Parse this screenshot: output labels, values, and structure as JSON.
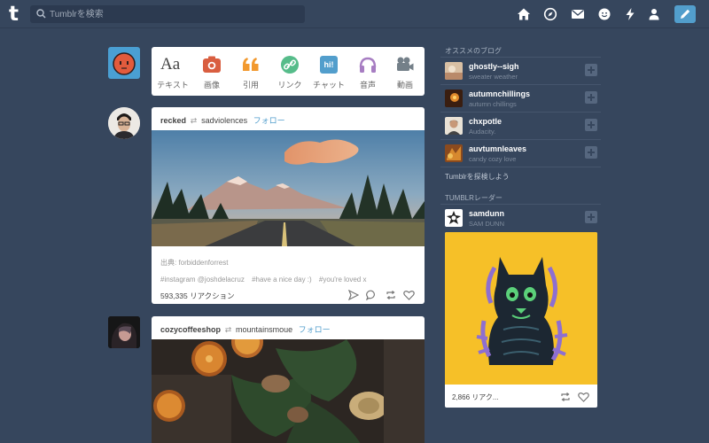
{
  "header": {
    "logo": "t",
    "search_placeholder": "Tumblrを検索",
    "nav_icons": [
      "home-icon",
      "explore-compass-icon",
      "inbox-mail-icon",
      "messages-smiley-icon",
      "activity-bolt-icon",
      "account-person-icon"
    ],
    "compose_icon": "pencil-icon"
  },
  "composer": {
    "types": [
      {
        "label": "テキスト",
        "icon": "text-Aa-icon",
        "glyph": "Aa",
        "color": "#444444"
      },
      {
        "label": "画像",
        "icon": "camera-icon",
        "color": "#d95e40"
      },
      {
        "label": "引用",
        "icon": "quote-icon",
        "color": "#f2992e"
      },
      {
        "label": "リンク",
        "icon": "link-icon",
        "color": "#56bc8a"
      },
      {
        "label": "チャット",
        "icon": "chat-icon",
        "glyph": "hi!",
        "color": "#529ecc"
      },
      {
        "label": "音声",
        "icon": "headphones-icon",
        "color": "#a77dc2"
      },
      {
        "label": "動画",
        "icon": "video-camera-icon",
        "color": "#748089"
      }
    ]
  },
  "posts": [
    {
      "user": "recked",
      "reblogged_from": "sadviolences",
      "follow": "フォロー",
      "source": "出典: forbiddenforrest",
      "tags": [
        "#instagram @joshdelacruz",
        "#have a nice day :)",
        "#you're loved x"
      ],
      "notes": "593,335 リアクション"
    },
    {
      "user": "cozycoffeeshop",
      "reblogged_from": "mountainsmoue",
      "follow": "フォロー"
    }
  ],
  "sidebar": {
    "recommended_heading": "オススメのブログ",
    "blogs": [
      {
        "name": "ghostly--sigh",
        "title": "sweater weather"
      },
      {
        "name": "autumnchillings",
        "title": "autumn chillings"
      },
      {
        "name": "chxpotle",
        "title": "Audacity."
      },
      {
        "name": "auvtumnleaves",
        "title": "candy cozy love"
      }
    ],
    "explore_link": "Tumblrを探検しよう",
    "radar_heading": "TUMBLRレーダー",
    "radar": {
      "name": "samdunn",
      "title": "SAM DUNN",
      "notes": "2,866 リアク..."
    }
  },
  "colors": {
    "background": "#36465d",
    "accent_blue": "#529ecc",
    "radar_yellow": "#f6c028"
  }
}
